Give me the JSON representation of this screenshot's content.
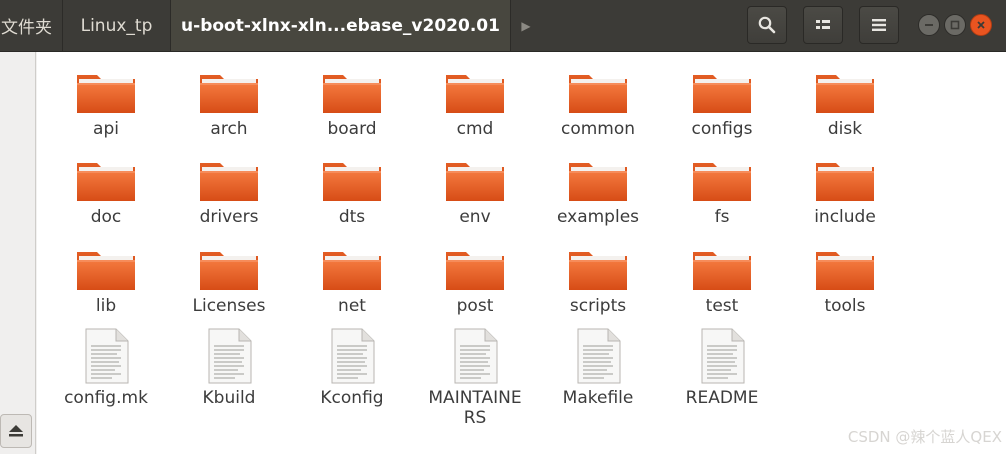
{
  "header": {
    "crumbs": [
      "文件夹",
      "Linux_tp",
      "u-boot-xlnx-xln...ebase_v2020.01"
    ],
    "arrow": "▶"
  },
  "icons": {
    "search": "search-icon",
    "view": "list-view-icon",
    "menu": "hamburger-menu-icon",
    "minimize": "minimize-icon",
    "maximize": "maximize-icon",
    "close": "close-icon",
    "eject": "eject-icon",
    "folder": "folder-icon",
    "file": "text-file-icon"
  },
  "colors": {
    "header_bg": "#3c3b37",
    "folder_top": "#f0692f",
    "folder_bottom": "#d74c16",
    "close_button": "#e95420"
  },
  "items": {
    "folders_row1": [
      "api",
      "arch",
      "board",
      "cmd",
      "common",
      "configs",
      "disk"
    ],
    "folders_row2": [
      "doc",
      "drivers",
      "dts",
      "env",
      "examples",
      "fs",
      "include"
    ],
    "folders_row3": [
      "lib",
      "Licenses",
      "net",
      "post",
      "scripts",
      "test",
      "tools"
    ],
    "files": [
      "config.mk",
      "Kbuild",
      "Kconfig",
      "MAINTAINERS",
      "Makefile",
      "README"
    ],
    "maintainers_line1": "MAINTAINE",
    "maintainers_line2": "RS"
  },
  "watermark": "CSDN @辣个蓝人QEX"
}
